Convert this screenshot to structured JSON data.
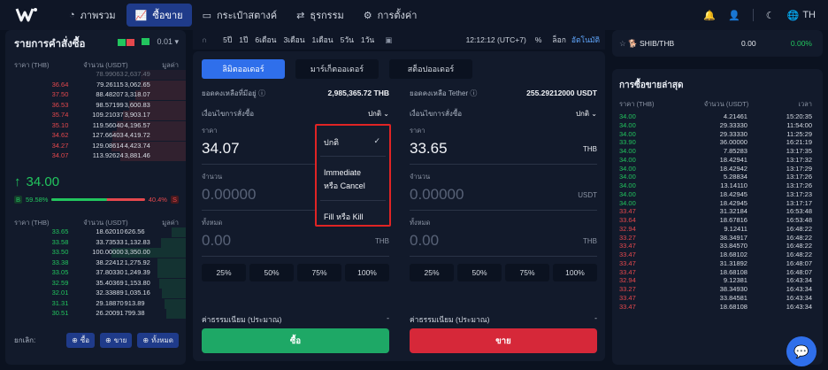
{
  "nav": {
    "items": [
      {
        "icon": "gauge-icon",
        "label": "ภาพรวม"
      },
      {
        "icon": "chart-icon",
        "label": "ซื้อขาย"
      },
      {
        "icon": "wallet-icon",
        "label": "กระเป๋าสตางค์"
      },
      {
        "icon": "transfer-icon",
        "label": "ธุรกรรม"
      },
      {
        "icon": "gear-icon",
        "label": "การตั้งค่า"
      }
    ],
    "active_index": 1,
    "lang": "TH"
  },
  "orderbook": {
    "title": "รายการคำสั่งซื้อ",
    "precision": "0.01",
    "columns": [
      "ราคา (THB)",
      "จำนวน (USDT)",
      "มูลค่า"
    ],
    "asks": [
      [
        "",
        "78.99063",
        "2,637.49"
      ],
      [
        "36.64",
        "79.26115",
        "3,062.65"
      ],
      [
        "37.50",
        "88.48207",
        "3,318.07"
      ],
      [
        "36.53",
        "98.57199",
        "3,600.83"
      ],
      [
        "35.74",
        "109.21037",
        "3,903.17"
      ],
      [
        "35.10",
        "119.56040",
        "4,196.57"
      ],
      [
        "34.62",
        "127.66403",
        "4,419.72"
      ],
      [
        "34.27",
        "129.08614",
        "4,423.74"
      ],
      [
        "34.07",
        "113.92624",
        "3,881.46"
      ]
    ],
    "last_price": "34.00",
    "buy_ratio": "59.58%",
    "sell_ratio": "40.4%",
    "buy_fraction": 0.596,
    "bids": [
      [
        "33.65",
        "18.62010",
        "626.56"
      ],
      [
        "33.58",
        "33.73533",
        "1,132.83"
      ],
      [
        "33.50",
        "100.00000",
        "3,350.00"
      ],
      [
        "33.38",
        "38.22412",
        "1,275.92"
      ],
      [
        "33.05",
        "37.80330",
        "1,249.39"
      ],
      [
        "32.59",
        "35.40369",
        "1,153.80"
      ],
      [
        "32.01",
        "32.33889",
        "1,035.16"
      ],
      [
        "31.31",
        "29.18870",
        "913.89"
      ],
      [
        "30.51",
        "26.20091",
        "799.38"
      ]
    ],
    "cancel_label": "ยกเลิก:",
    "cancel_buy": "ซื้อ",
    "cancel_sell": "ขาย",
    "cancel_all": "ทั้งหมด"
  },
  "strip": {
    "intervals": [
      "5ปี",
      "1ปี",
      "6เดือน",
      "3เดือน",
      "1เดือน",
      "5วัน",
      "1วัน"
    ],
    "time": "12:12:12 (UTC+7)",
    "percent": "%",
    "log": "ล็อก",
    "auto": "อัตโนมัติ"
  },
  "form": {
    "tabs": [
      "ลิมิตออเดอร์",
      "มาร์เก็ตออเดอร์",
      "สต็อปออเดอร์"
    ],
    "left": {
      "balance_label": "ยอดคงเหลือที่มีอยู่",
      "balance_value": "2,985,365.72 THB",
      "condition_label": "เงื่อนไขการสั่งซื้อ",
      "condition_value": "ปกติ",
      "price_label": "ราคา",
      "price_value": "34.07",
      "amount_label": "จำนวน",
      "amount_value": "0.00000",
      "total_label": "ทั้งหมด",
      "total_value": "0.00",
      "total_unit": "THB",
      "fee_label": "ค่าธรรมเนียม (ประมาณ)",
      "fee_value": "-",
      "action": "ซื้อ"
    },
    "right": {
      "balance_label": "ยอดคงเหลือ Tether",
      "balance_value": "255.29212000 USDT",
      "condition_label": "เงื่อนไขการสั่งซื้อ",
      "condition_value": "ปกติ",
      "price_label": "ราคา",
      "price_value": "33.65",
      "price_unit": "THB",
      "amount_label": "จำนวน",
      "amount_value": "0.00000",
      "amount_unit": "USDT",
      "total_label": "ทั้งหมด",
      "total_value": "0.00",
      "total_unit": "THB",
      "fee_label": "ค่าธรรมเนียม (ประมาณ)",
      "fee_value": "-",
      "action": "ขาย"
    },
    "percents": [
      "25%",
      "50%",
      "75%",
      "100%"
    ],
    "dropdown": {
      "options": [
        "ปกติ",
        "Immediate หรือ Cancel",
        "Fill หรือ Kill"
      ],
      "option_lines": [
        [
          "ปกติ"
        ],
        [
          "Immediate",
          "หรือ Cancel"
        ],
        [
          "Fill หรือ Kill"
        ]
      ],
      "selected_index": 0
    }
  },
  "ticker": {
    "symbol": "SHIB/THB",
    "price": "0.00",
    "change": "0.00%"
  },
  "trades": {
    "title": "การซื้อขายล่าสุด",
    "columns": [
      "ราคา (THB)",
      "จำนวน (USDT)",
      "เวลา"
    ],
    "rows": [
      [
        "34.00",
        "4.21461",
        "15:20:35",
        "b"
      ],
      [
        "34.00",
        "29.33330",
        "11:54:00",
        "b"
      ],
      [
        "34.00",
        "29.33330",
        "11:25:29",
        "b"
      ],
      [
        "33.90",
        "36.00000",
        "16:21:19",
        "b"
      ],
      [
        "34.00",
        "7.85283",
        "13:17:35",
        "b"
      ],
      [
        "34.00",
        "18.42941",
        "13:17:32",
        "b"
      ],
      [
        "34.00",
        "18.42942",
        "13:17:29",
        "b"
      ],
      [
        "34.00",
        "5.28834",
        "13:17:26",
        "b"
      ],
      [
        "34.00",
        "13.14110",
        "13:17:26",
        "b"
      ],
      [
        "34.00",
        "18.42945",
        "13:17:23",
        "b"
      ],
      [
        "34.00",
        "18.42945",
        "13:17:17",
        "b"
      ],
      [
        "33.47",
        "31.32184",
        "16:53:48",
        "s"
      ],
      [
        "33.64",
        "18.67816",
        "16:53:48",
        "s"
      ],
      [
        "32.94",
        "9.12411",
        "16:48:22",
        "s"
      ],
      [
        "33.27",
        "38.34917",
        "16:48:22",
        "s"
      ],
      [
        "33.47",
        "33.84570",
        "16:48:22",
        "s"
      ],
      [
        "33.47",
        "18.68102",
        "16:48:22",
        "s"
      ],
      [
        "33.47",
        "31.31892",
        "16:48:07",
        "s"
      ],
      [
        "33.47",
        "18.68108",
        "16:48:07",
        "s"
      ],
      [
        "32.94",
        "9.12381",
        "16:43:34",
        "s"
      ],
      [
        "33.27",
        "38.34930",
        "16:43:34",
        "s"
      ],
      [
        "33.47",
        "33.84581",
        "16:43:34",
        "s"
      ],
      [
        "33.47",
        "18.68108",
        "16:43:34",
        "s"
      ]
    ]
  },
  "colors": {
    "accent": "#2f6feb",
    "buy": "#22c55e",
    "sell": "#e5484d",
    "highlight": "#e02424"
  }
}
